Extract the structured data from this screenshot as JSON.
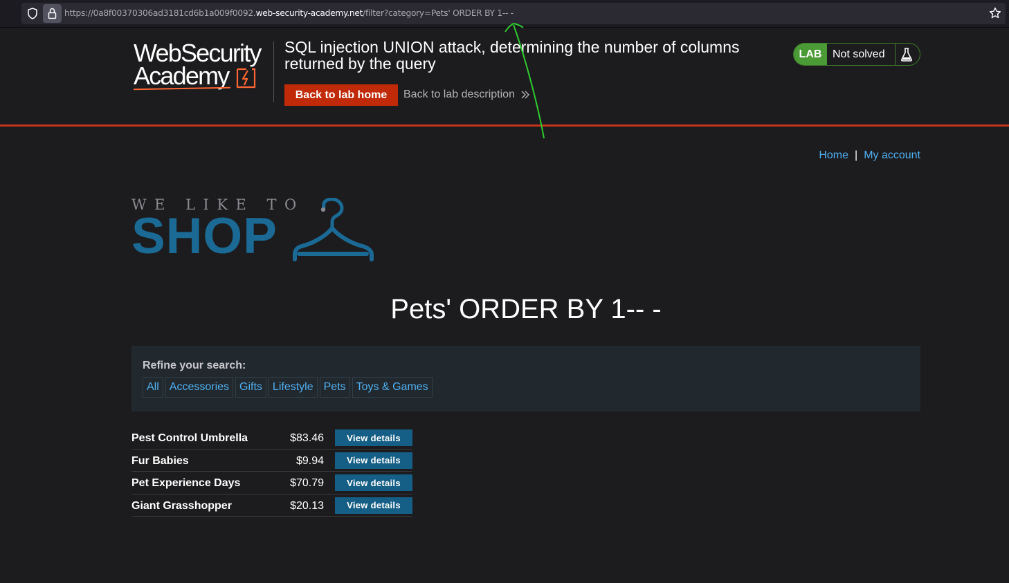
{
  "browser": {
    "url_prefix": "https://0a8f00370306ad3181cd6b1a009f0092.",
    "url_host": "web-security-academy.net",
    "url_path": "/filter?category=Pets' ORDER BY 1-- -"
  },
  "lab_header": {
    "logo_line1": "WebSecurity",
    "logo_line2": "Academy",
    "title": "SQL injection UNION attack, determining the number of columns returned by the query",
    "back_home_label": "Back to lab home",
    "back_description_label": "Back to lab description",
    "lab_badge": "LAB",
    "status": "Not solved"
  },
  "nav": {
    "home": "Home",
    "separator": "|",
    "my_account": "My account"
  },
  "shop_logo": {
    "tagline": "WE LIKE TO",
    "word": "SHOP"
  },
  "page": {
    "heading": "Pets' ORDER BY 1-- -"
  },
  "filter": {
    "label": "Refine your search:",
    "categories": [
      "All",
      "Accessories",
      "Gifts",
      "Lifestyle",
      "Pets",
      "Toys & Games"
    ]
  },
  "products": [
    {
      "name": "Pest Control Umbrella",
      "price": "$83.46",
      "action": "View details"
    },
    {
      "name": "Fur Babies",
      "price": "$9.94",
      "action": "View details"
    },
    {
      "name": "Pet Experience Days",
      "price": "$70.79",
      "action": "View details"
    },
    {
      "name": "Giant Grasshopper",
      "price": "$20.13",
      "action": "View details"
    }
  ],
  "colors": {
    "accent_orange": "#c12a08",
    "lab_green": "#4a9b35",
    "link_blue": "#4fb0f2",
    "shop_blue": "#1a6a95",
    "annotation_green": "#2ecc2e"
  }
}
